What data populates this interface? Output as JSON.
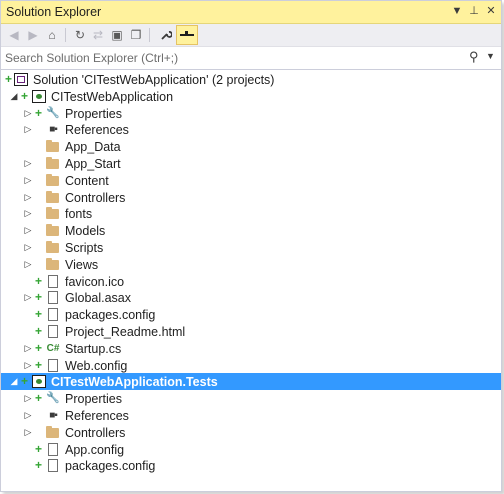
{
  "window": {
    "title": "Solution Explorer",
    "title_buttons": {
      "dropdown": "▼",
      "pin": "⊥",
      "close": "✕"
    },
    "accent": "#fff29d",
    "selection_color": "#3399ff"
  },
  "toolbar": {
    "buttons": [
      {
        "name": "back-button",
        "glyph": "◀",
        "disabled": true
      },
      {
        "name": "forward-button",
        "glyph": "▶",
        "disabled": true
      },
      {
        "name": "home-button",
        "glyph": "⌂",
        "disabled": false
      },
      {
        "name": "sync-button",
        "glyph": "↻",
        "disabled": false
      },
      {
        "name": "refresh-button",
        "glyph": "⇄",
        "disabled": true
      },
      {
        "name": "collapse-all-button",
        "glyph": "▣",
        "disabled": false
      },
      {
        "name": "show-all-files-button",
        "glyph": "❐",
        "disabled": false
      },
      {
        "name": "properties-button",
        "glyph": "🔧",
        "disabled": false
      },
      {
        "name": "preview-button",
        "glyph": "▬",
        "disabled": false
      }
    ]
  },
  "search": {
    "placeholder": "Search Solution Explorer (Ctrl+;)",
    "icon": "search-icon"
  },
  "tree": [
    {
      "label": "Solution 'CITestWebApplication' (2 projects)",
      "icon": "solution",
      "level": 0,
      "expander": "",
      "plus": true,
      "selected": false
    },
    {
      "label": "CITestWebApplication",
      "icon": "project",
      "level": 1,
      "expander": "◢",
      "plus": true,
      "selected": false
    },
    {
      "label": "Properties",
      "icon": "wrench",
      "level": 2,
      "expander": "▷",
      "plus": true,
      "selected": false
    },
    {
      "label": "References",
      "icon": "refs",
      "level": 2,
      "expander": "▷",
      "plus": false,
      "selected": false
    },
    {
      "label": "App_Data",
      "icon": "folder",
      "level": 2,
      "expander": "",
      "plus": false,
      "selected": false
    },
    {
      "label": "App_Start",
      "icon": "folder",
      "level": 2,
      "expander": "▷",
      "plus": false,
      "selected": false
    },
    {
      "label": "Content",
      "icon": "folder",
      "level": 2,
      "expander": "▷",
      "plus": false,
      "selected": false
    },
    {
      "label": "Controllers",
      "icon": "folder",
      "level": 2,
      "expander": "▷",
      "plus": false,
      "selected": false
    },
    {
      "label": "fonts",
      "icon": "folder",
      "level": 2,
      "expander": "▷",
      "plus": false,
      "selected": false
    },
    {
      "label": "Models",
      "icon": "folder",
      "level": 2,
      "expander": "▷",
      "plus": false,
      "selected": false
    },
    {
      "label": "Scripts",
      "icon": "folder",
      "level": 2,
      "expander": "▷",
      "plus": false,
      "selected": false
    },
    {
      "label": "Views",
      "icon": "folder",
      "level": 2,
      "expander": "▷",
      "plus": false,
      "selected": false
    },
    {
      "label": "favicon.ico",
      "icon": "file",
      "level": 2,
      "expander": "",
      "plus": true,
      "selected": false
    },
    {
      "label": "Global.asax",
      "icon": "file",
      "level": 2,
      "expander": "▷",
      "plus": true,
      "selected": false
    },
    {
      "label": "packages.config",
      "icon": "file",
      "level": 2,
      "expander": "",
      "plus": true,
      "selected": false
    },
    {
      "label": "Project_Readme.html",
      "icon": "file",
      "level": 2,
      "expander": "",
      "plus": true,
      "selected": false
    },
    {
      "label": "Startup.cs",
      "icon": "cs",
      "level": 2,
      "expander": "▷",
      "plus": true,
      "selected": false
    },
    {
      "label": "Web.config",
      "icon": "file",
      "level": 2,
      "expander": "▷",
      "plus": true,
      "selected": false
    },
    {
      "label": "CITestWebApplication.Tests",
      "icon": "project",
      "level": 1,
      "expander": "◢",
      "plus": true,
      "selected": true
    },
    {
      "label": "Properties",
      "icon": "wrench",
      "level": 2,
      "expander": "▷",
      "plus": true,
      "selected": false
    },
    {
      "label": "References",
      "icon": "refs",
      "level": 2,
      "expander": "▷",
      "plus": false,
      "selected": false
    },
    {
      "label": "Controllers",
      "icon": "folder",
      "level": 2,
      "expander": "▷",
      "plus": false,
      "selected": false
    },
    {
      "label": "App.config",
      "icon": "file",
      "level": 2,
      "expander": "",
      "plus": true,
      "selected": false
    },
    {
      "label": "packages.config",
      "icon": "file",
      "level": 2,
      "expander": "",
      "plus": true,
      "selected": false
    }
  ]
}
